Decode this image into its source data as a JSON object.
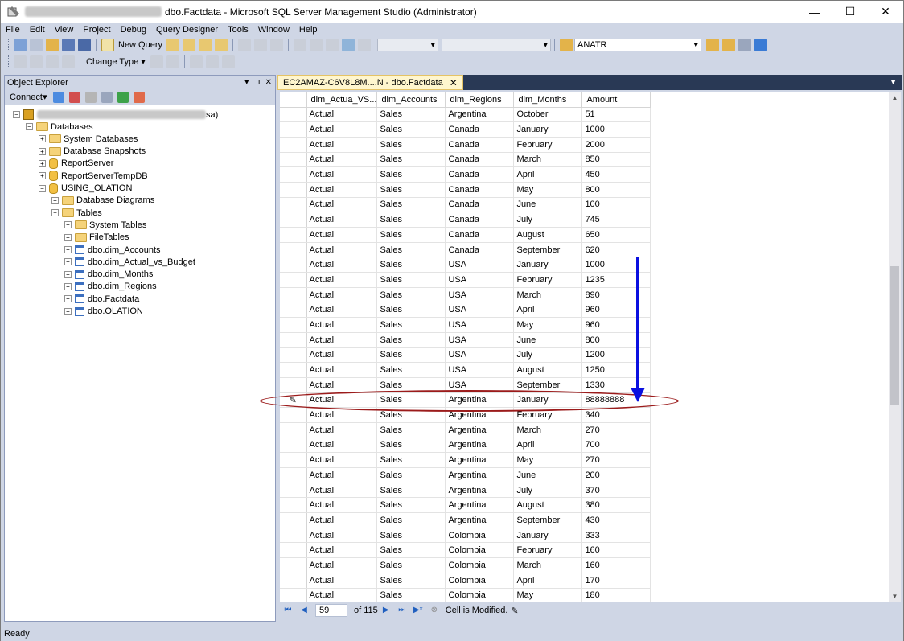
{
  "window": {
    "title": "dbo.Factdata - Microsoft SQL Server Management Studio (Administrator)",
    "minimize_glyph": "—",
    "maximize_glyph": "☐",
    "close_glyph": "✕"
  },
  "menu": [
    "File",
    "Edit",
    "View",
    "Project",
    "Debug",
    "Query Designer",
    "Tools",
    "Window",
    "Help"
  ],
  "toolbar1": {
    "new_query_label": "New Query",
    "database_combo": "ANATR"
  },
  "toolbar2": {
    "change_type_label": "Change Type"
  },
  "object_explorer": {
    "title": "Object Explorer",
    "pin_glyphs": [
      "▾",
      "⊐",
      "✕"
    ],
    "connect_label": "Connect",
    "server_suffix": "sa)",
    "nodes": [
      {
        "label": "Databases",
        "level": 1,
        "expander": "−",
        "icon": "folder-icon"
      },
      {
        "label": "System Databases",
        "level": 2,
        "expander": "+",
        "icon": "folder-icon"
      },
      {
        "label": "Database Snapshots",
        "level": 2,
        "expander": "+",
        "icon": "folder-icon"
      },
      {
        "label": "ReportServer",
        "level": 2,
        "expander": "+",
        "icon": "database-icon"
      },
      {
        "label": "ReportServerTempDB",
        "level": 2,
        "expander": "+",
        "icon": "database-icon"
      },
      {
        "label": "USING_OLATION",
        "level": 2,
        "expander": "−",
        "icon": "database-icon"
      },
      {
        "label": "Database Diagrams",
        "level": 3,
        "expander": "+",
        "icon": "folder-icon"
      },
      {
        "label": "Tables",
        "level": 3,
        "expander": "−",
        "icon": "folder-icon"
      },
      {
        "label": "System Tables",
        "level": 4,
        "expander": "+",
        "icon": "folder-icon"
      },
      {
        "label": "FileTables",
        "level": 4,
        "expander": "+",
        "icon": "folder-icon"
      },
      {
        "label": "dbo.dim_Accounts",
        "level": 4,
        "expander": "+",
        "icon": "table-icon"
      },
      {
        "label": "dbo.dim_Actual_vs_Budget",
        "level": 4,
        "expander": "+",
        "icon": "table-icon"
      },
      {
        "label": "dbo.dim_Months",
        "level": 4,
        "expander": "+",
        "icon": "table-icon"
      },
      {
        "label": "dbo.dim_Regions",
        "level": 4,
        "expander": "+",
        "icon": "table-icon"
      },
      {
        "label": "dbo.Factdata",
        "level": 4,
        "expander": "+",
        "icon": "table-icon"
      },
      {
        "label": "dbo.OLATION",
        "level": 4,
        "expander": "+",
        "icon": "table-icon"
      }
    ]
  },
  "document_tab": {
    "label": "EC2AMAZ-C6V8L8M....N - dbo.Factdata",
    "close_glyph": "✕"
  },
  "grid": {
    "columns": [
      "dim_Actua_VS...",
      "dim_Accounts",
      "dim_Regions",
      "dim_Months",
      "Amount"
    ],
    "edited_row_index": 19,
    "edited_marker": "✎",
    "rows": [
      [
        "Actual",
        "Sales",
        "Argentina",
        "October",
        "51"
      ],
      [
        "Actual",
        "Sales",
        "Canada",
        "January",
        "1000"
      ],
      [
        "Actual",
        "Sales",
        "Canada",
        "February",
        "2000"
      ],
      [
        "Actual",
        "Sales",
        "Canada",
        "March",
        "850"
      ],
      [
        "Actual",
        "Sales",
        "Canada",
        "April",
        "450"
      ],
      [
        "Actual",
        "Sales",
        "Canada",
        "May",
        "800"
      ],
      [
        "Actual",
        "Sales",
        "Canada",
        "June",
        "100"
      ],
      [
        "Actual",
        "Sales",
        "Canada",
        "July",
        "745"
      ],
      [
        "Actual",
        "Sales",
        "Canada",
        "August",
        "650"
      ],
      [
        "Actual",
        "Sales",
        "Canada",
        "September",
        "620"
      ],
      [
        "Actual",
        "Sales",
        "USA",
        "January",
        "1000"
      ],
      [
        "Actual",
        "Sales",
        "USA",
        "February",
        "1235"
      ],
      [
        "Actual",
        "Sales",
        "USA",
        "March",
        "890"
      ],
      [
        "Actual",
        "Sales",
        "USA",
        "April",
        "960"
      ],
      [
        "Actual",
        "Sales",
        "USA",
        "May",
        "960"
      ],
      [
        "Actual",
        "Sales",
        "USA",
        "June",
        "800"
      ],
      [
        "Actual",
        "Sales",
        "USA",
        "July",
        "1200"
      ],
      [
        "Actual",
        "Sales",
        "USA",
        "August",
        "1250"
      ],
      [
        "Actual",
        "Sales",
        "USA",
        "September",
        "1330"
      ],
      [
        "Actual",
        "Sales",
        "Argentina",
        "January",
        "88888888"
      ],
      [
        "Actual",
        "Sales",
        "Argentina",
        "February",
        "340"
      ],
      [
        "Actual",
        "Sales",
        "Argentina",
        "March",
        "270"
      ],
      [
        "Actual",
        "Sales",
        "Argentina",
        "April",
        "700"
      ],
      [
        "Actual",
        "Sales",
        "Argentina",
        "May",
        "270"
      ],
      [
        "Actual",
        "Sales",
        "Argentina",
        "June",
        "200"
      ],
      [
        "Actual",
        "Sales",
        "Argentina",
        "July",
        "370"
      ],
      [
        "Actual",
        "Sales",
        "Argentina",
        "August",
        "380"
      ],
      [
        "Actual",
        "Sales",
        "Argentina",
        "September",
        "430"
      ],
      [
        "Actual",
        "Sales",
        "Colombia",
        "January",
        "333"
      ],
      [
        "Actual",
        "Sales",
        "Colombia",
        "February",
        "160"
      ],
      [
        "Actual",
        "Sales",
        "Colombia",
        "March",
        "160"
      ],
      [
        "Actual",
        "Sales",
        "Colombia",
        "April",
        "170"
      ],
      [
        "Actual",
        "Sales",
        "Colombia",
        "May",
        "180"
      ]
    ]
  },
  "navigation": {
    "current_row": "59",
    "of_label": "of 115",
    "cell_status": "Cell is Modified."
  },
  "status": {
    "text": "Ready"
  },
  "colors": {
    "highlight_ellipse": "#9b1b1b",
    "arrow": "#0a10e0",
    "chrome": "#cfd6e5"
  }
}
